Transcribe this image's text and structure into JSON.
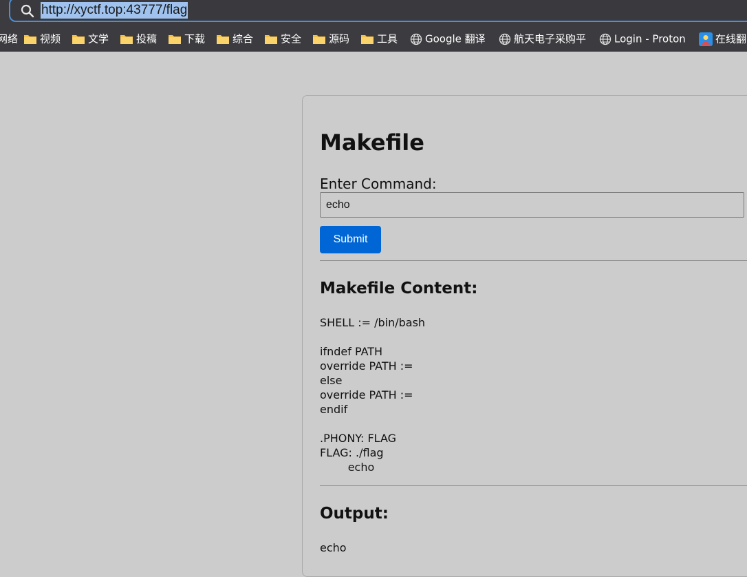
{
  "browser": {
    "url": "http://xyctf.top:43777/flag",
    "bookmarks": [
      {
        "label": "网络",
        "icon": "folder-icon"
      },
      {
        "label": "视频",
        "icon": "folder-icon"
      },
      {
        "label": "文学",
        "icon": "folder-icon"
      },
      {
        "label": "投稿",
        "icon": "folder-icon"
      },
      {
        "label": "下载",
        "icon": "folder-icon"
      },
      {
        "label": "综合",
        "icon": "folder-icon"
      },
      {
        "label": "安全",
        "icon": "folder-icon"
      },
      {
        "label": "源码",
        "icon": "folder-icon"
      },
      {
        "label": "工具",
        "icon": "folder-icon"
      },
      {
        "label": "Google 翻译",
        "icon": "globe-icon"
      },
      {
        "label": "航天电子采购平",
        "icon": "globe-icon"
      },
      {
        "label": "Login - Proton",
        "icon": "globe-icon"
      },
      {
        "label": "在线翻",
        "icon": "app-icon"
      }
    ]
  },
  "page": {
    "title": "Makefile",
    "command_label": "Enter Command:",
    "command_value": "echo",
    "submit_label": "Submit",
    "content_heading": "Makefile Content:",
    "makefile_lines": [
      "SHELL := /bin/bash",
      "ifndef PATH",
      "override PATH :=",
      "else",
      "override PATH :=",
      "endif",
      ".PHONY: FLAG",
      "FLAG: ./flag",
      "        echo"
    ],
    "output_heading": "Output:",
    "output_text": "echo"
  }
}
